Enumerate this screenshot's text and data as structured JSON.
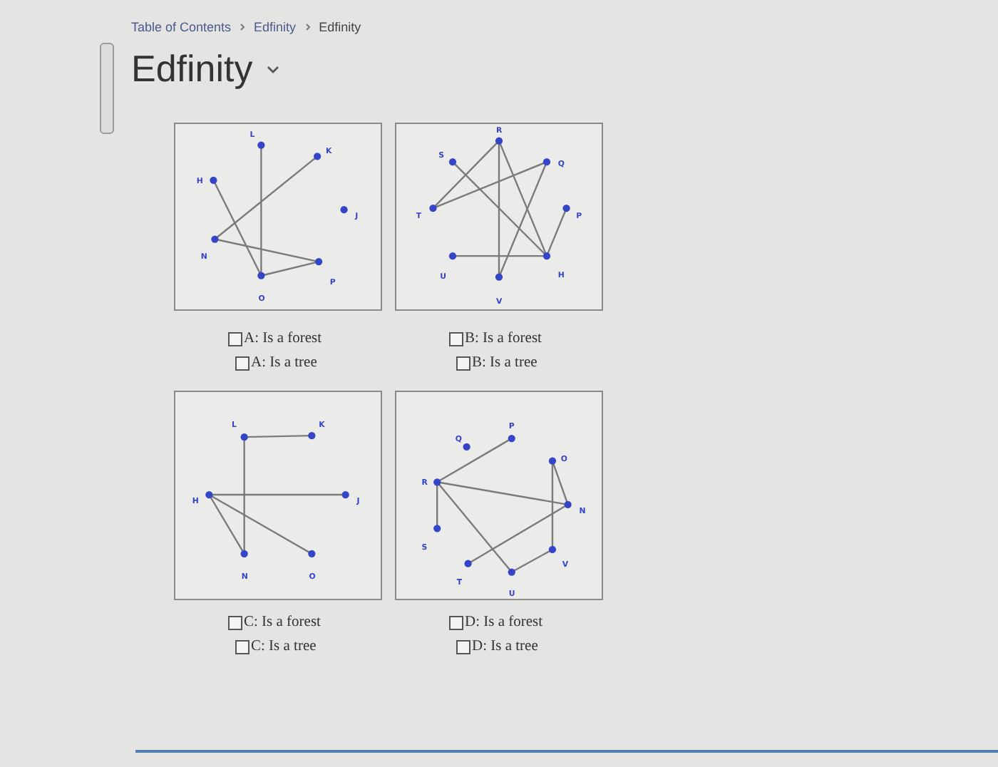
{
  "breadcrumb": [
    {
      "label": "Table of Contents"
    },
    {
      "label": "Edfinity"
    },
    {
      "label": "Edfinity"
    }
  ],
  "title": "Edfinity",
  "graphs": [
    {
      "nodes": [
        {
          "label": "L"
        },
        {
          "label": "K"
        },
        {
          "label": "H"
        },
        {
          "label": "J"
        },
        {
          "label": "N"
        },
        {
          "label": "P"
        },
        {
          "label": "O"
        }
      ],
      "options": [
        {
          "label": "A: Is a forest",
          "checked": false
        },
        {
          "label": "A: Is a tree",
          "checked": false
        }
      ]
    },
    {
      "nodes": [
        {
          "label": "R"
        },
        {
          "label": "S"
        },
        {
          "label": "Q"
        },
        {
          "label": "T"
        },
        {
          "label": "P"
        },
        {
          "label": "U"
        },
        {
          "label": "V"
        },
        {
          "label": "H"
        }
      ],
      "options": [
        {
          "label": "B: Is a forest",
          "checked": false
        },
        {
          "label": "B: Is a tree",
          "checked": false
        }
      ]
    },
    {
      "nodes": [
        {
          "label": "L"
        },
        {
          "label": "K"
        },
        {
          "label": "H"
        },
        {
          "label": "J"
        },
        {
          "label": "N"
        },
        {
          "label": "O"
        }
      ],
      "options": [
        {
          "label": "C: Is a forest",
          "checked": false
        },
        {
          "label": "C: Is a tree",
          "checked": false
        }
      ]
    },
    {
      "nodes": [
        {
          "label": "Q"
        },
        {
          "label": "P"
        },
        {
          "label": "O"
        },
        {
          "label": "R"
        },
        {
          "label": "N"
        },
        {
          "label": "S"
        },
        {
          "label": "V"
        },
        {
          "label": "T"
        },
        {
          "label": "U"
        }
      ],
      "options": [
        {
          "label": "D: Is a forest",
          "checked": false
        },
        {
          "label": "D: Is a tree",
          "checked": false
        }
      ]
    }
  ]
}
